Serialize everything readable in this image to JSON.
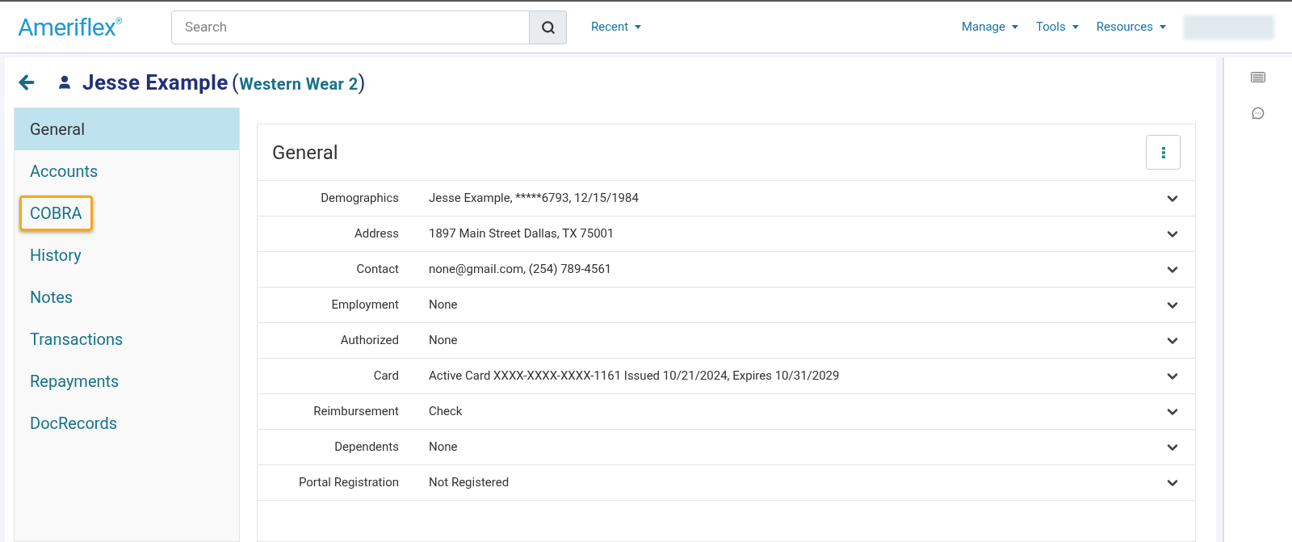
{
  "header": {
    "logo": "Ameriflex",
    "logo_mark": "®",
    "search": {
      "placeholder": "Search"
    },
    "left_menus": [
      {
        "label": "Recent"
      }
    ],
    "right_menus": [
      {
        "label": "Manage"
      },
      {
        "label": "Tools"
      },
      {
        "label": "Resources"
      }
    ]
  },
  "title": {
    "name": "Jesse Example",
    "open_paren": "(",
    "employer": "Western Wear 2",
    "close_paren": ")"
  },
  "sidebar": {
    "items": [
      {
        "label": "General",
        "selected": true,
        "highlighted": false
      },
      {
        "label": "Accounts",
        "selected": false,
        "highlighted": false
      },
      {
        "label": "COBRA",
        "selected": false,
        "highlighted": true
      },
      {
        "label": "History",
        "selected": false,
        "highlighted": false
      },
      {
        "label": "Notes",
        "selected": false,
        "highlighted": false
      },
      {
        "label": "Transactions",
        "selected": false,
        "highlighted": false
      },
      {
        "label": "Repayments",
        "selected": false,
        "highlighted": false
      },
      {
        "label": "DocRecords",
        "selected": false,
        "highlighted": false
      }
    ]
  },
  "card": {
    "title": "General",
    "rows": [
      {
        "label": "Demographics",
        "value": "Jesse Example, *****6793, 12/15/1984"
      },
      {
        "label": "Address",
        "value": "1897 Main Street Dallas, TX 75001"
      },
      {
        "label": "Contact",
        "value": "none@gmail.com, (254) 789-4561"
      },
      {
        "label": "Employment",
        "value": "None"
      },
      {
        "label": "Authorized",
        "value": "None"
      },
      {
        "label": "Card",
        "value": "Active Card XXXX-XXXX-XXXX-1161 Issued 10/21/2024, Expires 10/31/2029"
      },
      {
        "label": "Reimbursement",
        "value": "Check"
      },
      {
        "label": "Dependents",
        "value": "None"
      },
      {
        "label": "Portal Registration",
        "value": "Not Registered"
      }
    ]
  }
}
